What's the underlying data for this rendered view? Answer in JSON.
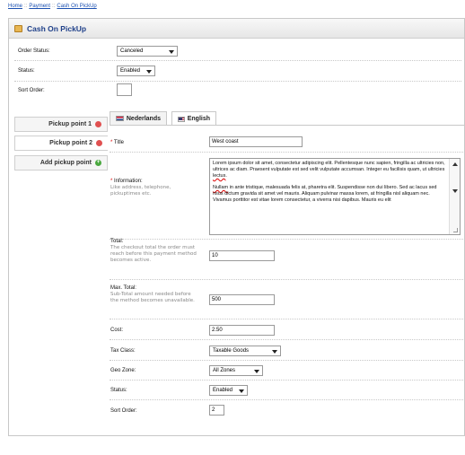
{
  "breadcrumb": {
    "home": "Home",
    "sep": "::",
    "payment": "Payment",
    "current": "Cash On PickUp"
  },
  "heading": {
    "title": "Cash On PickUp",
    "icon": "payment-icon"
  },
  "main_form": {
    "order_status": {
      "label": "Order Status:",
      "value": "Canceled"
    },
    "status": {
      "label": "Status:",
      "value": "Enabled"
    },
    "sort_order": {
      "label": "Sort Order:",
      "value": ""
    }
  },
  "vtabs": [
    {
      "label": "Pickup point 1",
      "icon": "remove-icon",
      "color": "#e05050"
    },
    {
      "label": "Pickup point 2",
      "icon": "remove-icon",
      "color": "#e05050"
    },
    {
      "label": "Add pickup point",
      "icon": "add-icon",
      "color": "#4aa83f"
    }
  ],
  "lang_tabs": [
    {
      "label": "Nederlands",
      "icon": "flag-nl-icon"
    },
    {
      "label": "English",
      "icon": "flag-en-icon"
    }
  ],
  "point_form": {
    "title": {
      "required": "*",
      "label": "Title",
      "value": "West coast"
    },
    "information": {
      "required": "*",
      "label": "Information:",
      "help": "Like address, telephone, pickuptimes etc.",
      "paragraph1": "Lorem ipsum dolor sit amet, consectetur adipiscing elit. Pellentesque nunc sapien, fringilla ac ultricies non, ultrices ac diam. Praesent vulputate est sed velit vulputate accumsan. Integer eu facilisis quam, ut ultricies",
      "paragraph1_misspelled": "lectus",
      "paragraph1_end": ".",
      "paragraph2_misspelled": "Nullam",
      "paragraph2": " in ante tristique, malesuada felis at, pharetra elit. Suspendisse non dui libero. Sed ac lacus sed risus dictum gravida sit amet vel mauris. Aliquam pulvinar massa lorem, at fringilla nisl aliquam nec. Vivamus porttitor est vitae lorem consectetur, a viverra nisi dapibus. Mauris eu elit"
    },
    "total": {
      "label": "Total:",
      "help": "The checkout total the order must reach before this payment method becomes active.",
      "value": "10"
    },
    "max_total": {
      "label": "Max. Total:",
      "help": "Sub-Total amount needed before the method becomes unavailable.",
      "value": "500"
    },
    "cost": {
      "label": "Cost:",
      "value": "2.50"
    },
    "tax_class": {
      "label": "Tax Class:",
      "value": "Taxable Goods"
    },
    "geo_zone": {
      "label": "Geo Zone:",
      "value": "All Zones"
    },
    "status": {
      "label": "Status:",
      "value": "Enabled"
    },
    "sort_order": {
      "label": "Sort Order:",
      "value": "2"
    }
  }
}
